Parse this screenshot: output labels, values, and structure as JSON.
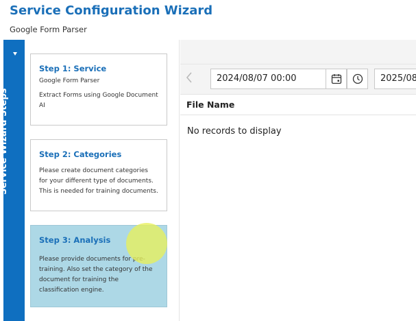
{
  "header": {
    "title": "Service Configuration Wizard",
    "subtitle": "Google Form Parser"
  },
  "sidebar": {
    "tab_label": "Service Wizard Steps",
    "toggle_icon": "caret-down-icon",
    "accent_color": "#0f6fc0"
  },
  "steps": [
    {
      "title": "Step 1: Service",
      "subtitle": "Google Form Parser",
      "description": "Extract Forms using Google Document AI",
      "active": false
    },
    {
      "title": "Step 2: Categories",
      "subtitle": "",
      "description": "Please create document categories for your different type of documents. This is needed for training documents.",
      "active": false
    },
    {
      "title": "Step 3: Analysis",
      "subtitle": "",
      "description": "Please provide documents for pre-training. Also set the category of the document for training the classification engine.",
      "active": true,
      "active_color": "#add8e6"
    }
  ],
  "toolbar": {
    "back_icon": "chevron-left-icon",
    "start_date": "2024/08/07 00:00",
    "end_date": "2025/08/",
    "calendar_icon": "calendar-icon",
    "clock_icon": "clock-icon"
  },
  "grid": {
    "columns": [
      "File Name"
    ],
    "empty_message": "No records to display"
  },
  "colors": {
    "title": "#1a6fb8",
    "cursor_highlight": "#e8f05a"
  }
}
